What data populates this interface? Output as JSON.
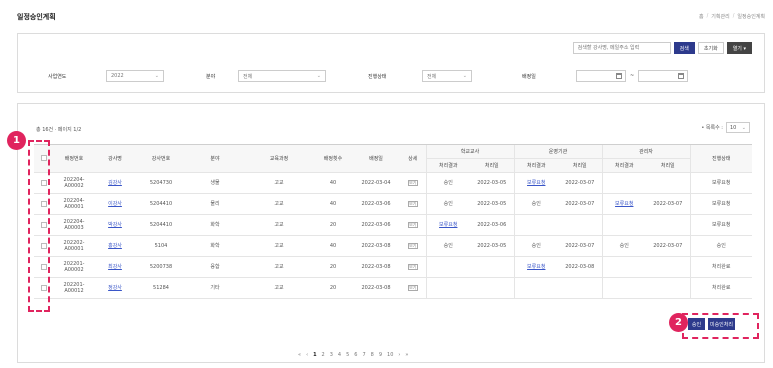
{
  "page": {
    "title": "일정승인계획",
    "breadcrumb": [
      "홈",
      "기획관리",
      "일정승인계획"
    ]
  },
  "filters": {
    "search_placeholder": "검색할 강사명, 메일주소 입력",
    "search_button": "검색",
    "reset_button": "초기화",
    "more_button": "열기 ▾",
    "year_label": "사업연도",
    "year_value": "2022",
    "field_label": "분야",
    "field_value": "전체",
    "progress_label": "진행상태",
    "progress_value": "전체",
    "date_label": "배정일",
    "date_sep": "~"
  },
  "list": {
    "count_text": "총 16건 · 페이지 1/2",
    "per_page_label": "• 목록수 :",
    "per_page_value": "10",
    "headers": {
      "plan_no": "배정번호",
      "instructor": "강사명",
      "instructor_id": "강사번호",
      "field": "분야",
      "level": "교육과정",
      "count": "배정횟수",
      "date": "배정일",
      "detail": "상세",
      "school": "학교교사",
      "org": "운영기관",
      "manager": "관리자",
      "status": "진행상태",
      "result": "처리결과",
      "result_date": "처리일"
    },
    "rows": [
      {
        "no1": "202204-",
        "no2": "A00002",
        "name": "김강사",
        "id": "5204730",
        "field": "생물",
        "level": "고교",
        "count": "40",
        "date": "2022-03-04",
        "detail": "보기",
        "s_res": "승인",
        "s_date": "2022-03-05",
        "o_res": "보류요청",
        "o_date": "2022-03-07",
        "m_res": "",
        "m_date": "",
        "status": "보류요청"
      },
      {
        "no1": "202204-",
        "no2": "A00001",
        "name": "이강사",
        "id": "5204410",
        "field": "물리",
        "level": "고교",
        "count": "40",
        "date": "2022-03-06",
        "detail": "보기",
        "s_res": "승인",
        "s_date": "2022-03-05",
        "o_res": "승인",
        "o_date": "2022-03-07",
        "m_res": "보류요청",
        "m_date": "2022-03-07",
        "status": "보류요청"
      },
      {
        "no1": "202204-",
        "no2": "A00003",
        "name": "박강사",
        "id": "5204410",
        "field": "화학",
        "level": "고교",
        "count": "20",
        "date": "2022-03-06",
        "detail": "보기",
        "s_res": "보류요청",
        "s_date": "2022-03-06",
        "o_res": "",
        "o_date": "",
        "m_res": "",
        "m_date": "",
        "status": "보류요청"
      },
      {
        "no1": "202202-",
        "no2": "A00001",
        "name": "홍강사",
        "id": "5104",
        "field": "화학",
        "level": "고교",
        "count": "40",
        "date": "2022-03-08",
        "detail": "보기",
        "s_res": "승인",
        "s_date": "2022-03-05",
        "o_res": "승인",
        "o_date": "2022-03-07",
        "m_res": "승인",
        "m_date": "2022-03-07",
        "status": "승인"
      },
      {
        "no1": "202201-",
        "no2": "A00002",
        "name": "최강사",
        "id": "5200738",
        "field": "융합",
        "level": "고교",
        "count": "20",
        "date": "2022-03-08",
        "detail": "보기",
        "s_res": "",
        "s_date": "",
        "o_res": "보류요청",
        "o_date": "2022-03-08",
        "m_res": "",
        "m_date": "",
        "status": "처리완료"
      },
      {
        "no1": "202201-",
        "no2": "A00012",
        "name": "정강사",
        "id": "51284",
        "field": "기타",
        "level": "고교",
        "count": "20",
        "date": "2022-03-08",
        "detail": "보기",
        "s_res": "",
        "s_date": "",
        "o_res": "",
        "o_date": "",
        "m_res": "",
        "m_date": "",
        "status": "처리완료"
      }
    ],
    "approve_button": "승인",
    "reject_button": "미승인처리"
  },
  "pager": [
    "«",
    "‹",
    "1",
    "2",
    "3",
    "4",
    "5",
    "6",
    "7",
    "8",
    "9",
    "10",
    "›",
    "»"
  ],
  "annotations": {
    "badge1": "1",
    "badge2": "2",
    "highlight_color": "#e0245e"
  },
  "colors": {
    "accent": "#2d3a8c",
    "link": "#3a56c8"
  }
}
